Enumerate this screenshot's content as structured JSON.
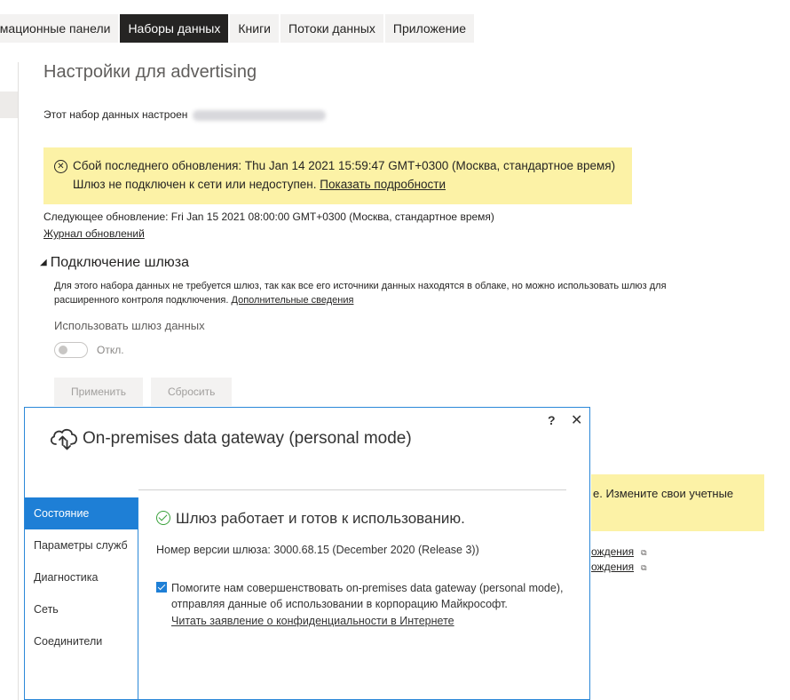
{
  "tabs": [
    {
      "label": "рмационные панели",
      "active": false
    },
    {
      "label": "Наборы данных",
      "active": true
    },
    {
      "label": "Книги",
      "active": false
    },
    {
      "label": "Потоки данных",
      "active": false
    },
    {
      "label": "Приложение",
      "active": false
    }
  ],
  "page": {
    "title": "Настройки для advertising",
    "config_text": "Этот набор данных настроен"
  },
  "warning": {
    "line1": "Сбой последнего обновления: Thu Jan 14 2021 15:59:47 GMT+0300 (Москва, стандартное время)",
    "line2": "Шлюз не подключен к сети или недоступен.",
    "details_link": "Показать подробности"
  },
  "refresh": {
    "next": "Следующее обновление: Fri Jan 15 2021 08:00:00 GMT+0300 (Москва, стандартное время)",
    "history_link": "Журнал обновлений"
  },
  "gateway_section": {
    "heading": "Подключение шлюза",
    "description": "Для этого набора данных не требуется шлюз, так как все его источники данных находятся в облаке, но можно использовать шлюз для расширенного контроля подключения.",
    "more_link": "Дополнительные сведения",
    "use_gateway_label": "Использовать шлюз данных",
    "toggle_state": "Откл.",
    "apply_button": "Применить",
    "reset_button": "Сбросить"
  },
  "background_right": {
    "warn_text": "е. Измените свои учетные",
    "link1": "ождения",
    "link2": "ождения"
  },
  "dialog": {
    "help": "?",
    "close": "✕",
    "title": "On-premises data gateway (personal mode)",
    "nav": [
      {
        "label": "Состояние",
        "active": true
      },
      {
        "label": "Параметры служб",
        "active": false
      },
      {
        "label": "Диагностика",
        "active": false
      },
      {
        "label": "Сеть",
        "active": false
      },
      {
        "label": "Соединители",
        "active": false
      }
    ],
    "status": "Шлюз работает и готов к использованию.",
    "version": "Номер версии шлюза: 3000.68.15 (December 2020 (Release 3))",
    "consent": "Помогите нам совершенствовать on-premises data gateway (personal mode), отправляя данные об использовании в корпорацию Майкрософт.",
    "consent_checked": true,
    "privacy_link": "Читать заявление о конфиденциальности в Интернете"
  },
  "colors": {
    "tab_active": "#252423",
    "warning_bg": "#fcf2a6",
    "accent": "#1e7fd6",
    "ok": "#38a13a"
  }
}
